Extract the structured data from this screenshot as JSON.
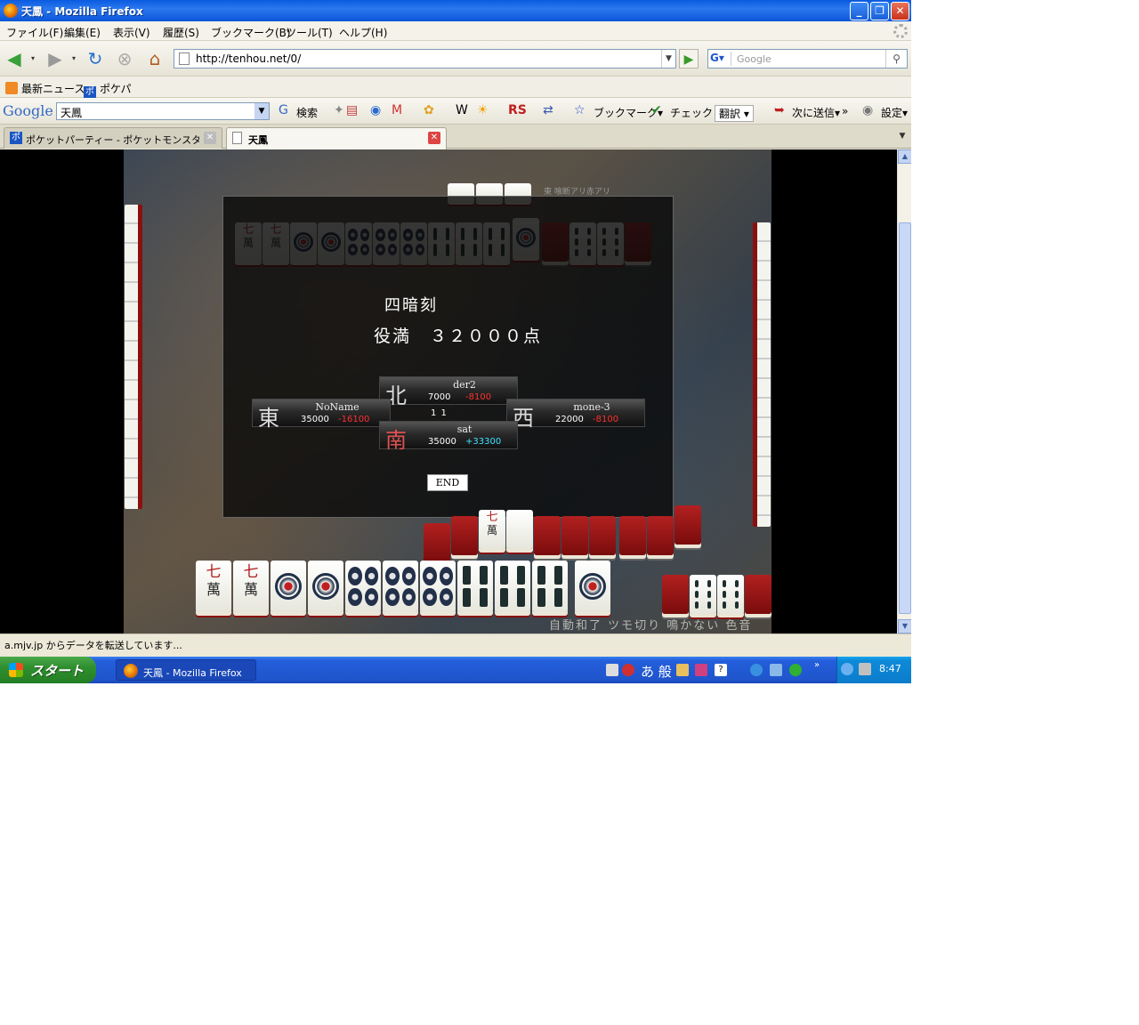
{
  "window": {
    "title": "天鳳 - Mozilla Firefox"
  },
  "menu": [
    "ファイル(F)",
    "編集(E)",
    "表示(V)",
    "履歴(S)",
    "ブックマーク(B)",
    "ツール(T)",
    "ヘルプ(H)"
  ],
  "nav": {
    "url": "http://tenhou.net/0/",
    "search_placeholder": "Google"
  },
  "bookmarks": [
    "最新ニュース",
    "ポケパ"
  ],
  "google_toolbar": {
    "logo": "Google",
    "search_value": "天鳳",
    "items": [
      "検索",
      "ブックマーク▾",
      "チェック",
      "翻訳",
      "次に送信▾",
      "設定▾"
    ]
  },
  "tabs": [
    {
      "label": "ポケットパーティー - ポケットモンスターPB...",
      "active": false
    },
    {
      "label": "天鳳",
      "active": true
    }
  ],
  "game": {
    "rules": "東 喰断アリ赤アリ",
    "yaku": "四暗刻",
    "yakuman": "役満　３２０００点",
    "players": [
      {
        "wind": "北",
        "name": "der2",
        "score": "7000",
        "delta": "-8100"
      },
      {
        "wind": "東",
        "name": "NoName",
        "score": "35000",
        "delta": "-16100"
      },
      {
        "wind": "西",
        "name": "mone-3",
        "score": "22000",
        "delta": "-8100"
      },
      {
        "wind": "南",
        "name": "sat",
        "score": "35000",
        "delta": "+33300"
      }
    ],
    "end_button": "END",
    "center_info": "1  1",
    "options": "自動和了 ツモ切り 鳴かない 色音",
    "tile_labels": {
      "seven": "七",
      "man": "萬"
    }
  },
  "status": "a.mjv.jp からデータを転送しています...",
  "taskbar": {
    "start": "スタート",
    "item": "天鳳 - Mozilla Firefox",
    "ime": "あ 般",
    "clock": "8:47"
  },
  "colors": {
    "titlebar": "#0a5be0",
    "negative": "#ff3030",
    "positive": "#40e0ff",
    "tile_back": "#b22020"
  }
}
